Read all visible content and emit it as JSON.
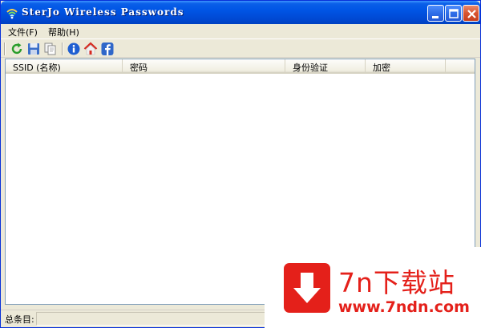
{
  "window": {
    "title": "SterJo Wireless Passwords"
  },
  "menu": {
    "items": [
      {
        "label": "文件(F)"
      },
      {
        "label": "帮助(H)"
      }
    ]
  },
  "toolbar": {
    "buttons": [
      {
        "icon": "refresh-icon"
      },
      {
        "icon": "save-icon"
      },
      {
        "icon": "copy-icon"
      },
      {
        "icon": "info-icon"
      },
      {
        "icon": "home-icon"
      },
      {
        "icon": "facebook-icon"
      }
    ]
  },
  "list": {
    "columns": [
      "SSID (名称)",
      "密码",
      "身份验证",
      "加密"
    ],
    "rows": []
  },
  "status": {
    "label": "总条目:"
  },
  "watermark": {
    "title": "7n下载站",
    "url": "www.7ndn.com"
  },
  "colors": {
    "titlebar": "#0055e5",
    "chrome": "#ece9d8",
    "watermark": "#e4201a"
  }
}
